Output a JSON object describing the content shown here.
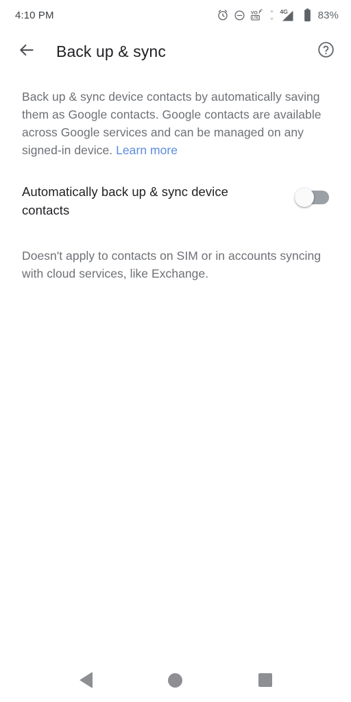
{
  "status_bar": {
    "time": "4:10 PM",
    "battery_percent": "83%",
    "network_type": "4G",
    "volte_label": "VO",
    "volte_sub_label": "LTE",
    "icons": [
      "alarm-icon",
      "do-not-disturb-icon",
      "volte-icon",
      "data-transfer-icon",
      "signal-4g-icon",
      "battery-icon"
    ]
  },
  "app_bar": {
    "title": "Back up & sync",
    "back_icon": "back-arrow-icon",
    "help_icon": "help-circle-icon"
  },
  "content": {
    "intro_text": "Back up & sync device contacts by automatically saving them as Google contacts. Google contacts are available across Google services and can be managed on any signed-in device. ",
    "learn_more_label": "Learn more",
    "preference": {
      "label": "Automatically back up & sync device contacts",
      "toggle_state": "off"
    },
    "note_text": "Doesn't apply to contacts on SIM or in accounts syncing with cloud services, like Exchange."
  },
  "nav_bar": {
    "back_label": "Back",
    "home_label": "Home",
    "recents_label": "Recents"
  },
  "colors": {
    "link": "#5b8cdd",
    "primary_text": "#202124",
    "secondary_text": "#6d7075",
    "switch_track_off": "#9aa0a6",
    "nav_icon": "#8d8f92",
    "background": "#ffffff"
  }
}
